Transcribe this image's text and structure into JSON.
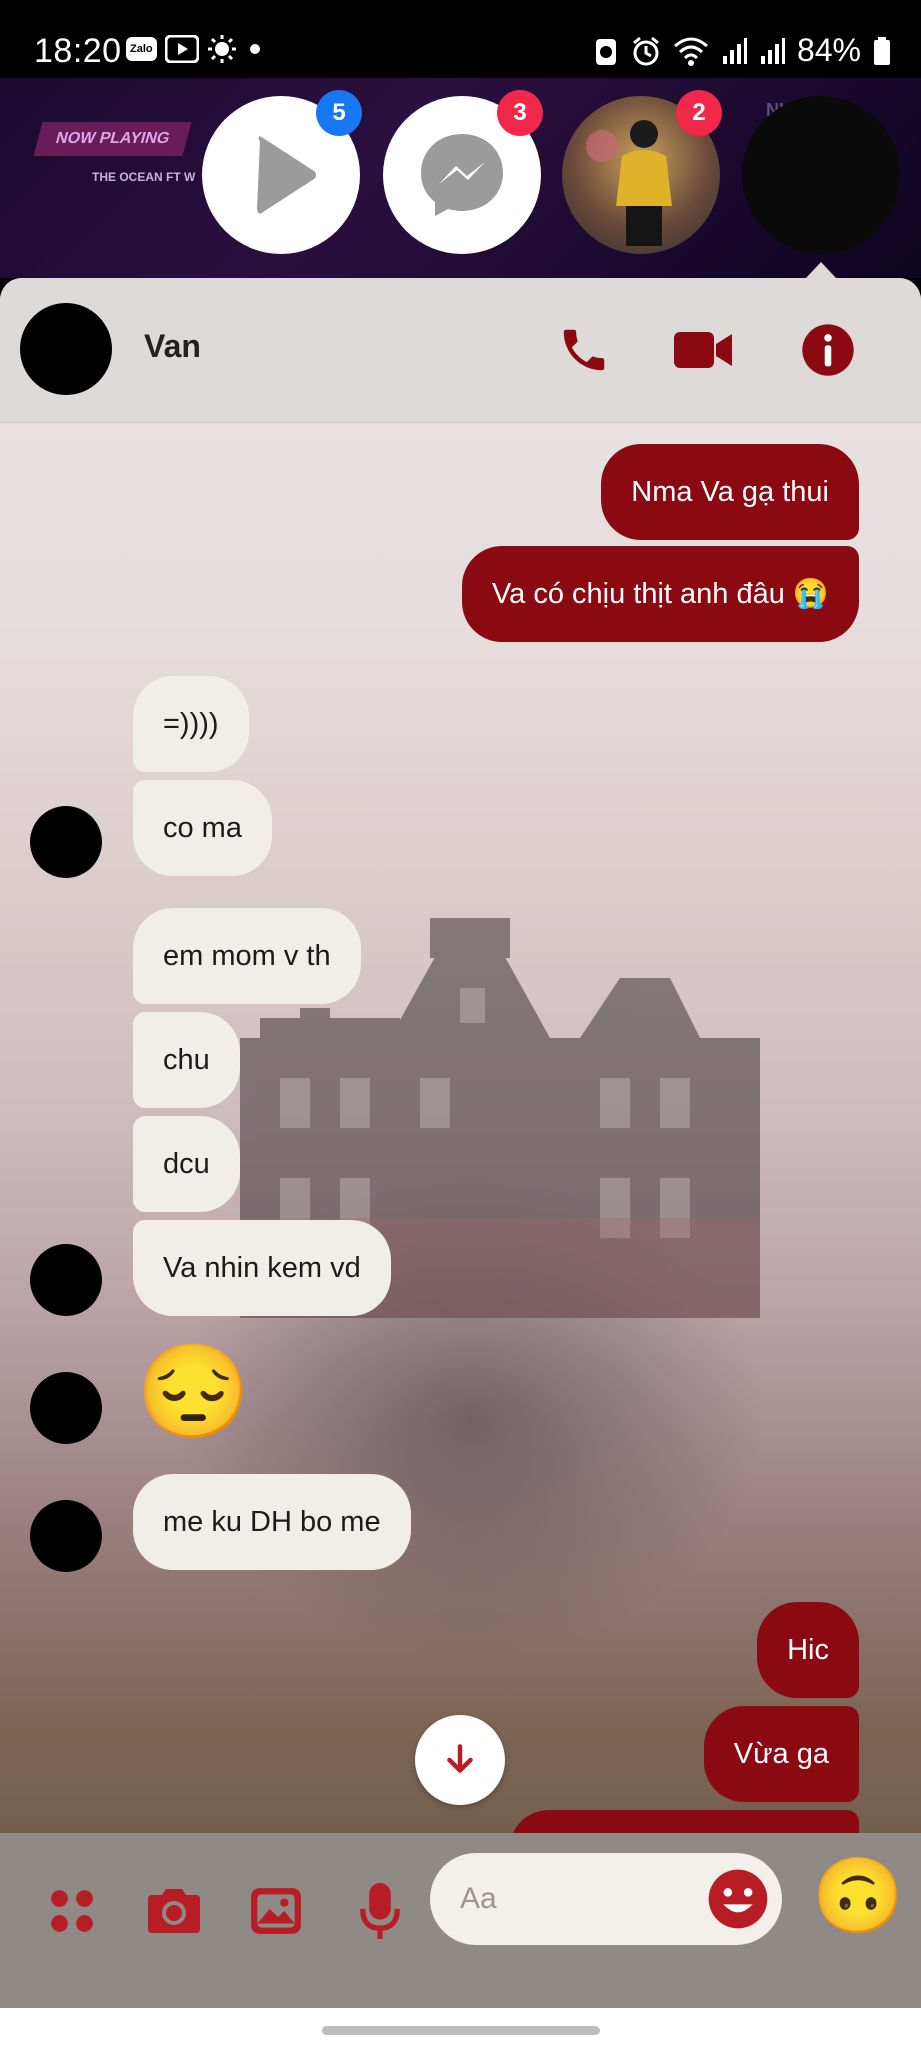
{
  "status_bar": {
    "time": "18:20",
    "battery": "84%",
    "left_icons": [
      "zalo-icon",
      "youtube-icon",
      "brightness-icon",
      "dot-icon"
    ],
    "right_icons": [
      "battery-saver-icon",
      "alarm-icon",
      "wifi-icon",
      "signal-icon",
      "signal-icon",
      "battery-icon"
    ]
  },
  "chat_heads": [
    {
      "name": "play-chathead",
      "badge": "5",
      "badge_color": "#1877f2"
    },
    {
      "name": "messenger-chathead",
      "badge": "3",
      "badge_color": "#f02849"
    },
    {
      "name": "contact-photo-chathead",
      "badge": "2",
      "badge_color": "#f02849"
    }
  ],
  "background_player": {
    "now_playing": "NOW PLAYING",
    "track": "THE OCEAN FT W",
    "right_text": "NI"
  },
  "header": {
    "contact_name": "Van",
    "icons": [
      "phone-icon",
      "video-camera-icon",
      "info-icon"
    ]
  },
  "messages": {
    "out_1": "Nma Va gạ thui",
    "out_2": "Va có chịu thịt anh đâu 😭",
    "in_1": "=))))",
    "in_2": "co ma",
    "in_3": "em mom v th",
    "in_4": "chu",
    "in_5": "dcu",
    "in_6": "Va nhin kem vd",
    "in_emoji": "😔",
    "in_7": "me ku DH bo me",
    "out_3": "Hic",
    "out_4": "Vừa ga"
  },
  "composer": {
    "placeholder": "Aa",
    "quick_reaction": "🙃",
    "icons": [
      "apps-grid-icon",
      "camera-icon",
      "gallery-icon",
      "microphone-icon",
      "emoji-icon"
    ]
  },
  "colors": {
    "accent": "#8b0a12",
    "incoming_bubble": "#f1eee9",
    "header_bg": "#dedad7",
    "composer_bg": "#8f8a85"
  }
}
